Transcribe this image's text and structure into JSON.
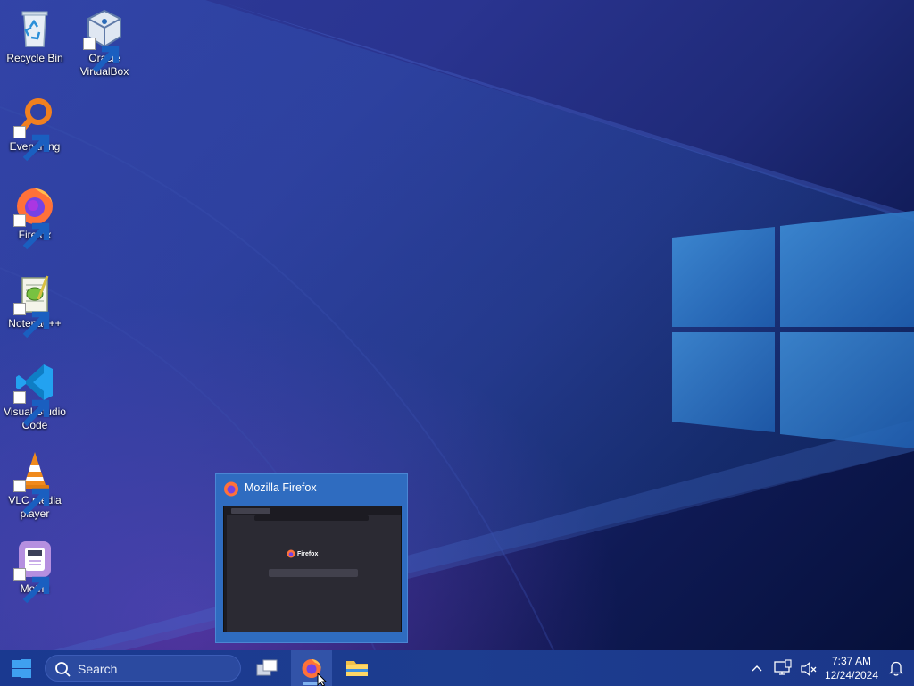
{
  "desktop": {
    "icons": [
      {
        "label": "Recycle Bin",
        "icon": "recycle-bin-icon",
        "shortcut": false
      },
      {
        "label": "Oracle VirtualBox",
        "icon": "virtualbox-icon",
        "shortcut": true
      },
      {
        "label": "Everything",
        "icon": "everything-search-icon",
        "shortcut": true
      },
      {
        "label": "Firefox",
        "icon": "firefox-icon",
        "shortcut": true
      },
      {
        "label": "Notepad++",
        "icon": "notepadpp-icon",
        "shortcut": true
      },
      {
        "label": "Visual Studio Code",
        "icon": "vscode-icon",
        "shortcut": true
      },
      {
        "label": "VLC media player",
        "icon": "vlc-icon",
        "shortcut": true
      },
      {
        "label": "Motrix",
        "icon": "motrix-icon",
        "shortcut": true
      }
    ]
  },
  "preview": {
    "title": "Mozilla Firefox",
    "thumbnail": {
      "brand": "Firefox"
    }
  },
  "taskbar": {
    "search_placeholder": "Search",
    "apps": [
      {
        "name": "Task View",
        "icon": "task-view-icon"
      },
      {
        "name": "Firefox",
        "icon": "firefox-icon",
        "active": true
      },
      {
        "name": "File Explorer",
        "icon": "folder-icon"
      }
    ],
    "clock": {
      "time": "7:37 AM",
      "date": "12/24/2024"
    }
  },
  "colors": {
    "taskbar": "#1d3b8c",
    "preview_bg": "#2f6cc0",
    "accent": "#7fb2f0"
  }
}
